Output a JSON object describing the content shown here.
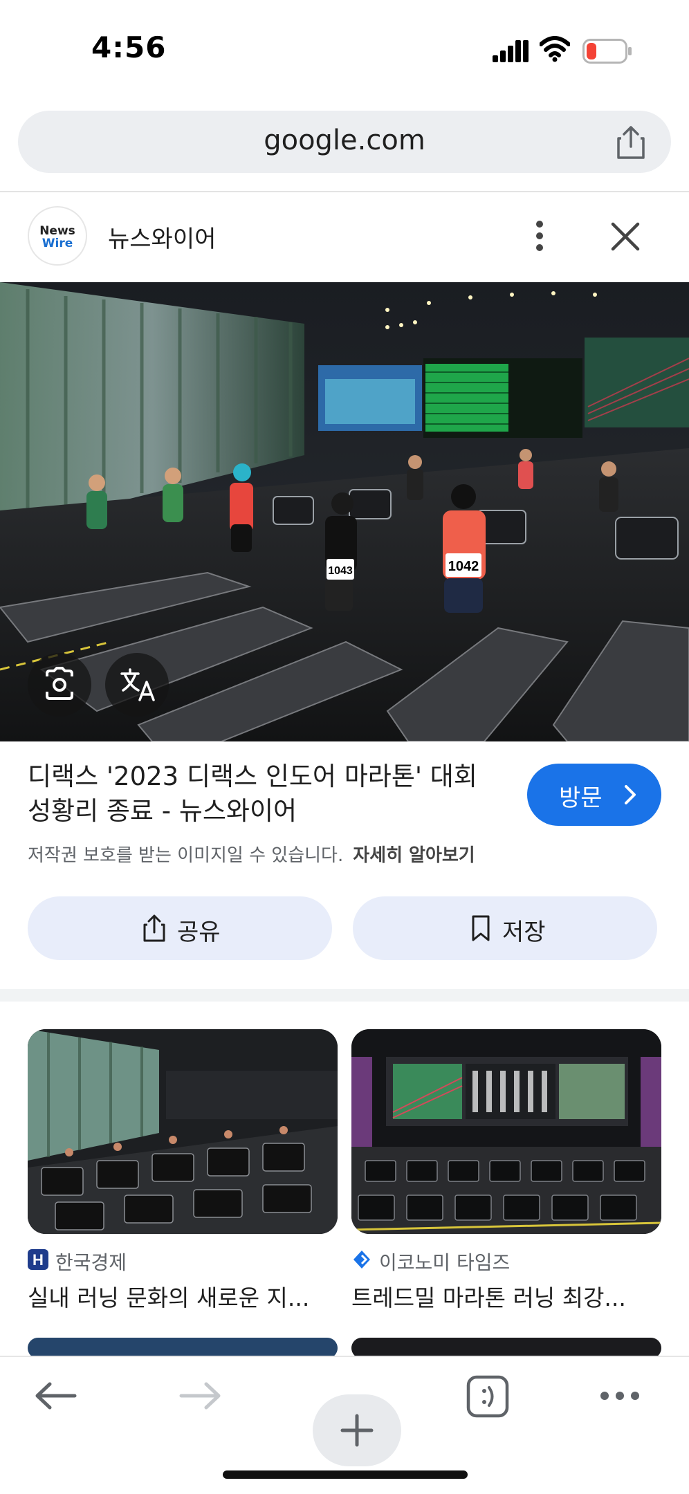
{
  "status_bar": {
    "time": "4:56",
    "battery_color": "#f44336"
  },
  "browser": {
    "url": "google.com"
  },
  "source": {
    "logo_line1": "News",
    "logo_line2": "Wire",
    "name": "뉴스와이어"
  },
  "image_result": {
    "title": "디랙스 '2023 디랙스 인도어 마라톤' 대회 성황리 종료 - 뉴스와이어",
    "visit_label": "방문",
    "copyright_notice": "저작권 보호를 받는 이미지일 수 있습니다.",
    "learn_more": "자세히 알아보기",
    "share_label": "공유",
    "save_label": "저장",
    "bib_numbers": [
      "1043",
      "1042"
    ]
  },
  "related": [
    {
      "source": "한국경제",
      "title": "실내 러닝 문화의 새로운 지...",
      "badge_letter": "H",
      "badge_color": "#1f3c8c"
    },
    {
      "source": "이코노미 타임즈",
      "title": "트레드밀 마라톤 러닝 최강...",
      "badge_color": "#1a73e8"
    }
  ],
  "colors": {
    "accent": "#1a73e8",
    "pill_bg": "#e8edfa"
  },
  "icons": [
    "signal-icon",
    "wifi-icon",
    "battery-icon",
    "share-icon",
    "more-vert-icon",
    "close-icon",
    "lens-icon",
    "translate-icon",
    "chevron-right-icon",
    "bookmark-icon",
    "back-icon",
    "forward-icon",
    "plus-icon",
    "tabs-icon",
    "more-horiz-icon"
  ]
}
